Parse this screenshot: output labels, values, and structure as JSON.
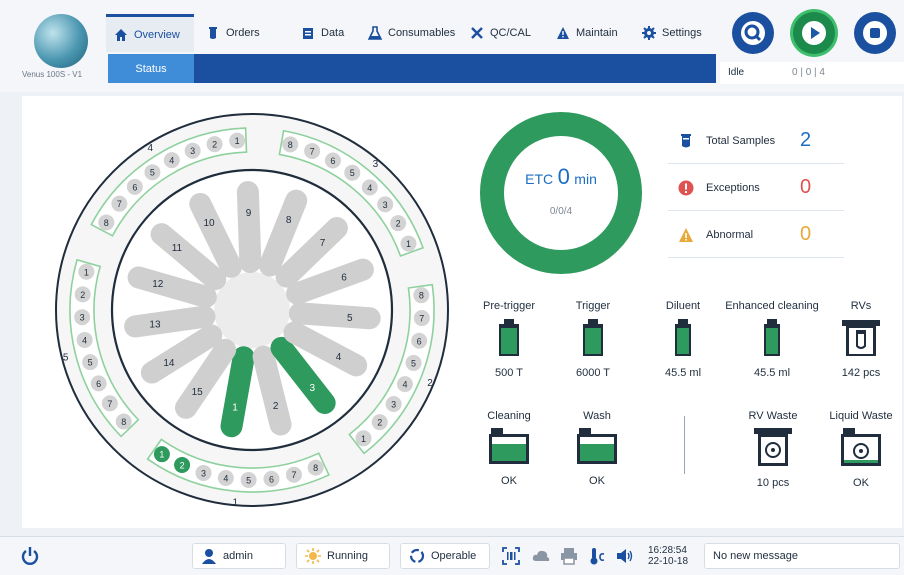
{
  "app": {
    "name": "Venus 100S - V1"
  },
  "nav": {
    "tabs": [
      {
        "label": "Overview",
        "icon": "home-icon"
      },
      {
        "label": "Orders",
        "icon": "tube-icon"
      },
      {
        "label": "Data",
        "icon": "clipboard-icon"
      },
      {
        "label": "Consumables",
        "icon": "flask-icon"
      },
      {
        "label": "QC/CAL",
        "icon": "tools-icon"
      },
      {
        "label": "Maintain",
        "icon": "warning-icon"
      },
      {
        "label": "Settings",
        "icon": "gear-icon"
      }
    ],
    "subtab": "Status"
  },
  "controls": {
    "state": "Idle",
    "counts": "0 | 0 | 4"
  },
  "carousel": {
    "sample_tray_numbers": [
      "1",
      "2",
      "3",
      "4",
      "5"
    ],
    "reaction_positions": [
      "1",
      "2",
      "3",
      "4",
      "5",
      "6",
      "7",
      "8",
      "9",
      "10",
      "11",
      "12",
      "13",
      "14",
      "15"
    ],
    "active_reaction_positions": [
      "1",
      "3"
    ],
    "rack_slot_labels": [
      "1",
      "2",
      "3",
      "4",
      "5",
      "6",
      "7",
      "8"
    ],
    "active_rack1_slots": [
      "1",
      "2"
    ]
  },
  "etc": {
    "label": "ETC",
    "value": "0",
    "unit": "min",
    "progress": "0/0/4"
  },
  "summary": [
    {
      "label": "Total Samples",
      "value": "2",
      "color": "#1b6fc2",
      "icon": "tube-icon"
    },
    {
      "label": "Exceptions",
      "value": "0",
      "color": "#e05252",
      "icon": "exclamation-icon"
    },
    {
      "label": "Abnormal",
      "value": "0",
      "color": "#e8a93a",
      "icon": "warning-icon"
    }
  ],
  "consumables": {
    "top": [
      {
        "name": "Pre-trigger",
        "value": "500 T"
      },
      {
        "name": "Trigger",
        "value": "6000 T"
      },
      {
        "name": "Diluent",
        "value": "45.5 ml"
      },
      {
        "name": "Enhanced cleaning",
        "value": "45.5 ml"
      },
      {
        "name": "RVs",
        "value": "142 pcs"
      }
    ],
    "bottom": [
      {
        "name": "Cleaning",
        "value": "OK"
      },
      {
        "name": "Wash",
        "value": "OK"
      },
      {
        "name": "RV Waste",
        "value": "10 pcs"
      },
      {
        "name": "Liquid Waste",
        "value": "OK"
      }
    ]
  },
  "footer": {
    "user": "admin",
    "run_state": "Running",
    "system_state": "Operable",
    "time": "16:28:54",
    "date": "22-10-18",
    "message": "No new message"
  },
  "colors": {
    "primary": "#1b4fa0",
    "accent_green": "#2e9a5e",
    "tube_gray": "#cfcfcf"
  }
}
